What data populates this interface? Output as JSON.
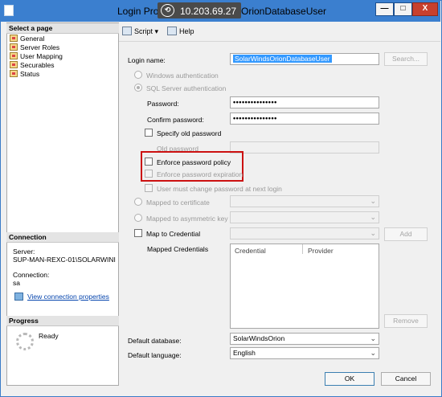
{
  "window": {
    "title_pre": "Login Pro",
    "rdp_ip": "10.203.69.27",
    "title_post": "OrionDatabaseUser",
    "controls": {
      "minimize": "—",
      "maximize": "□",
      "close": "X"
    }
  },
  "left_pane": {
    "select_page_header": "Select a page",
    "pages": [
      "General",
      "Server Roles",
      "User Mapping",
      "Securables",
      "Status"
    ],
    "connection_header": "Connection",
    "server_label": "Server:",
    "server_value": "SUP-MAN-REXC-01\\SOLARWINI",
    "connection_label": "Connection:",
    "connection_value": "sa",
    "view_props_link": "View connection properties",
    "progress_header": "Progress",
    "progress_status": "Ready"
  },
  "toolbar": {
    "script_label": "Script",
    "help_label": "Help",
    "script_icon": "script-icon",
    "help_icon": "help-icon"
  },
  "form": {
    "login_name_label": "Login name:",
    "login_name_value": "SolarWindsOrionDatabaseUser",
    "search_button": "Search...",
    "windows_auth_label": "Windows authentication",
    "sql_auth_label": "SQL Server authentication",
    "password_label": "Password:",
    "password_value": "•••••••••••••••",
    "confirm_password_label": "Confirm password:",
    "confirm_password_value": "•••••••••••••••",
    "specify_old_password_label": "Specify old password",
    "old_password_label": "Old password",
    "enforce_policy_label": "Enforce password policy",
    "enforce_expiration_label": "Enforce password expiration",
    "must_change_label": "User must change password at next login",
    "mapped_cert_label": "Mapped to certificate",
    "mapped_asym_label": "Mapped to asymmetric key",
    "map_credential_label": "Map to Credential",
    "add_button": "Add",
    "mapped_credentials_label": "Mapped Credentials",
    "cred_col": "Credential",
    "provider_col": "Provider",
    "remove_button": "Remove",
    "default_db_label": "Default database:",
    "default_db_value": "SolarWindsOrion",
    "default_lang_label": "Default language:",
    "default_lang_value": "English"
  },
  "footer": {
    "ok_button": "OK",
    "cancel_button": "Cancel"
  },
  "colors": {
    "titlebar": "#3b7fcf",
    "highlight": "#cc1111",
    "selection": "#3399ff"
  }
}
